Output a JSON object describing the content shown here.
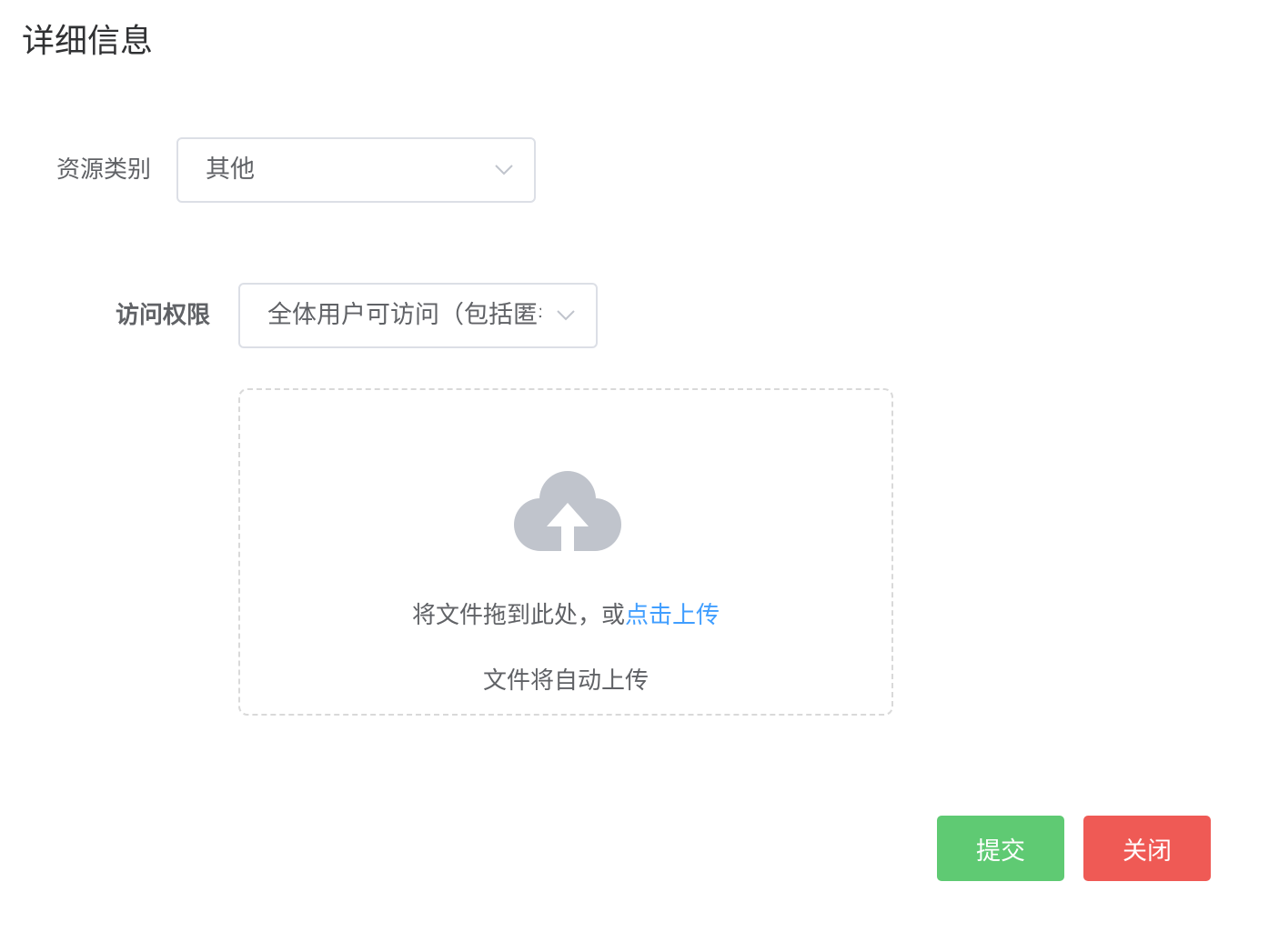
{
  "page": {
    "title": "详细信息"
  },
  "form": {
    "resource_type": {
      "label": "资源类别",
      "value": "其他"
    },
    "access": {
      "label": "访问权限",
      "value": "全体用户可访问（包括匿名用户）"
    }
  },
  "upload": {
    "icon": "cloud-upload-icon",
    "drag_text": "将文件拖到此处，或",
    "click_text": "点击上传",
    "tip": "文件将自动上传"
  },
  "actions": {
    "submit_label": "提交",
    "close_label": "关闭"
  },
  "colors": {
    "submit": "#5fca73",
    "close": "#ef5a55",
    "link": "#409eff",
    "upload_icon": "#c0c4cc"
  }
}
